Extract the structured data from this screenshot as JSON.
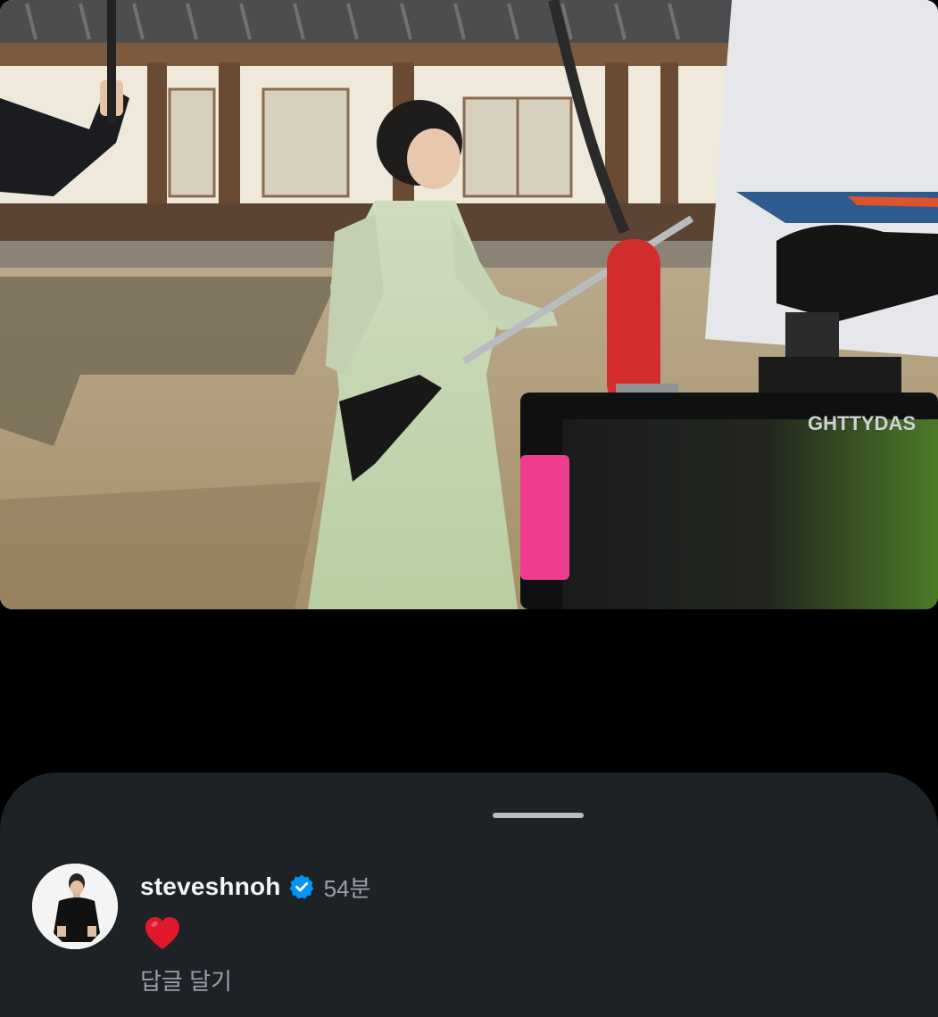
{
  "media": {
    "description_icon": "video-frame",
    "monitor_brand": "GHTTYDAS"
  },
  "sheet": {
    "comment": {
      "username": "steveshnoh",
      "verified": true,
      "time": "54분",
      "reaction": "❤️",
      "reply_label": "답글 달기"
    }
  },
  "colors": {
    "sheet_bg": "#1c2226",
    "verified_blue": "#0095f6",
    "heart_red": "#e0182d",
    "muted_text": "#9aa0a6"
  }
}
